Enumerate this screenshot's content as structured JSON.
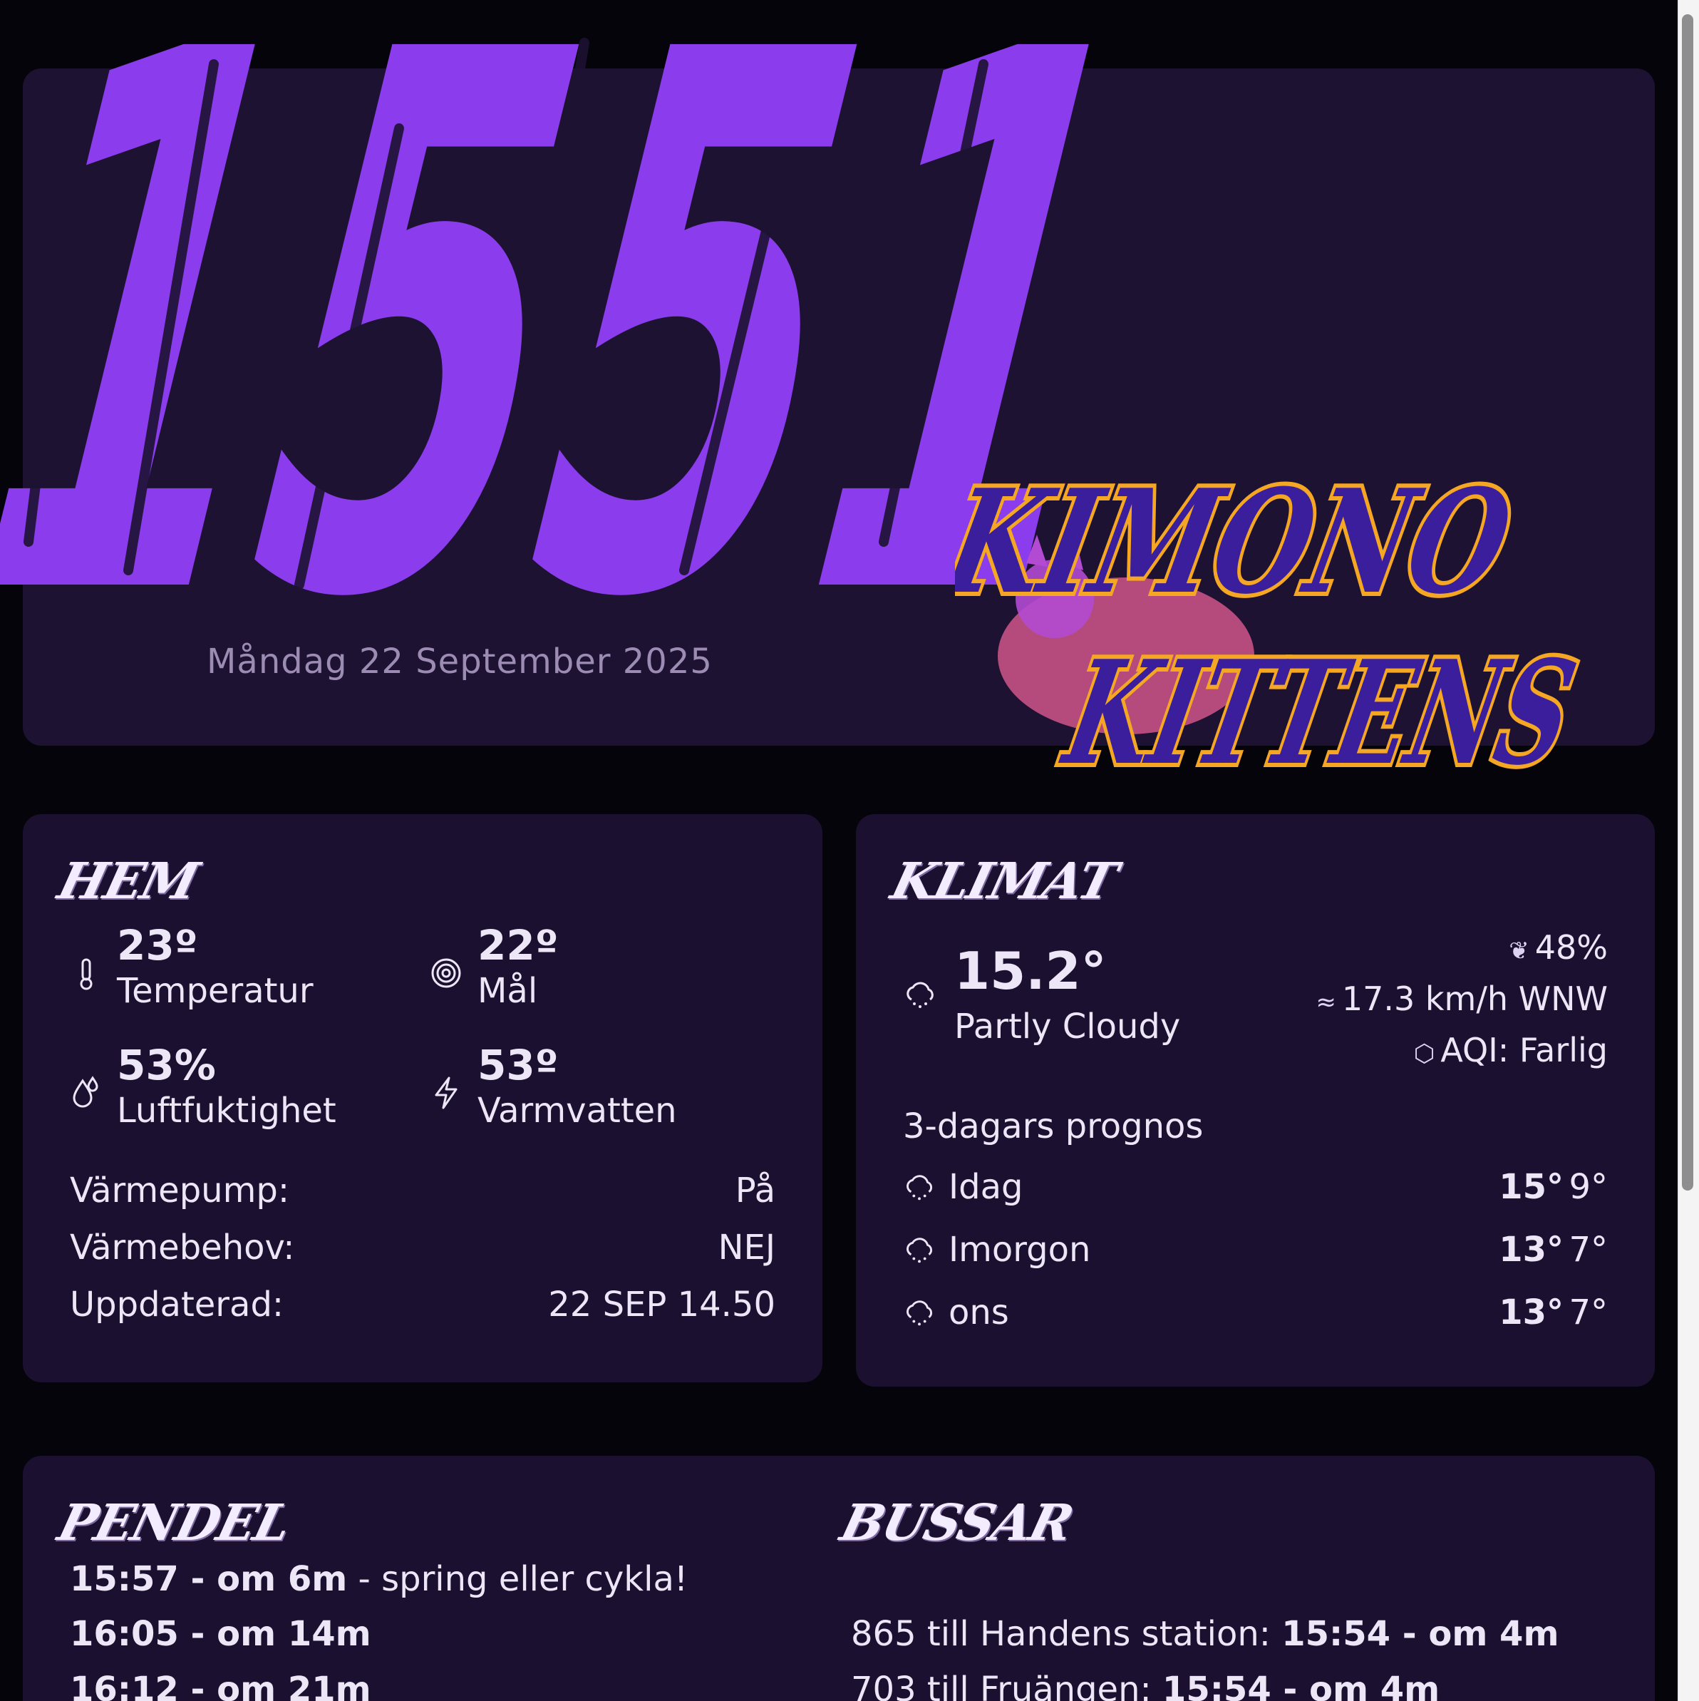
{
  "clock": {
    "time": "1551",
    "date": "Måndag 22 September 2025"
  },
  "logo": {
    "line1": "KIMONO",
    "line2": "KITTENS"
  },
  "hem": {
    "title": "HEM",
    "stats": [
      {
        "icon": "thermometer-icon",
        "value": "23º",
        "label": "Temperatur"
      },
      {
        "icon": "target-icon",
        "value": "22º",
        "label": "Mål"
      },
      {
        "icon": "humidity-icon",
        "value": "53%",
        "label": "Luftfuktighet"
      },
      {
        "icon": "bolt-icon",
        "value": "53º",
        "label": "Varmvatten"
      }
    ],
    "rows": [
      {
        "label": "Värmepump:",
        "value": "På"
      },
      {
        "label": "Värmebehov:",
        "value": "NEJ"
      },
      {
        "label": "Uppdaterad:",
        "value": "22 SEP 14.50"
      }
    ]
  },
  "klimat": {
    "title": "KLIMAT",
    "temp": "15.2°",
    "condition": "Partly Cloudy",
    "humidity": "48%",
    "wind": "17.3 km/h WNW",
    "aqi": "AQI: Farlig",
    "forecast_title": "3-dagars prognos",
    "forecast": [
      {
        "day": "Idag",
        "hi": "15°",
        "lo": "9°"
      },
      {
        "day": "Imorgon",
        "hi": "13°",
        "lo": "7°"
      },
      {
        "day": "ons",
        "hi": "13°",
        "lo": "7°"
      }
    ]
  },
  "pendel": {
    "title": "PENDEL",
    "departures": [
      {
        "time": "15:57 - om 6m",
        "note": " - spring eller cykla!"
      },
      {
        "time": "16:05 - om 14m",
        "note": ""
      },
      {
        "time": "16:12 - om 21m",
        "note": ""
      }
    ]
  },
  "bussar": {
    "title": "BUSSAR",
    "departures": [
      {
        "route": "865 till Handens station: ",
        "time": "15:54 - om 4m"
      },
      {
        "route": "703 till Fruängen: ",
        "time": "15:54 - om 4m"
      }
    ]
  },
  "colors": {
    "accent": "#8b3ded",
    "card": "#1b1030",
    "background": "#05040a",
    "logo_outline": "#f5a623"
  }
}
